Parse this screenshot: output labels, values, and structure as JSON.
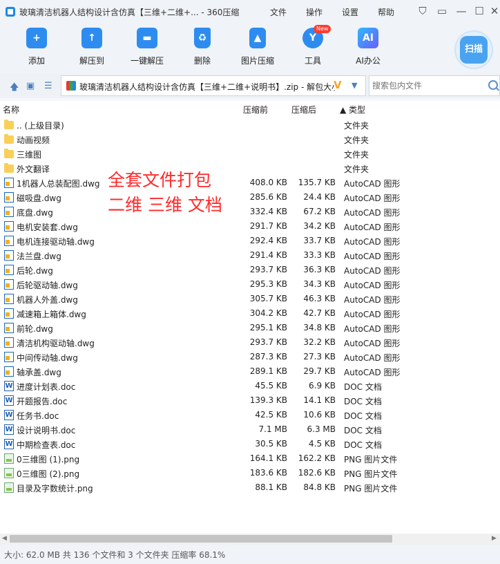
{
  "window": {
    "title": "玻璃清洁机器人结构设计含仿真【三维+二维+... - 360压缩",
    "menu": [
      "文件",
      "操作",
      "设置",
      "帮助"
    ]
  },
  "toolbar": {
    "tools": [
      {
        "label": "添加",
        "icon": "add-icon",
        "color": "#2d8cf0"
      },
      {
        "label": "解压到",
        "icon": "extract-icon",
        "color": "#2d8cf0"
      },
      {
        "label": "一键解压",
        "icon": "one-click-extract-icon",
        "color": "#2d8cf0"
      },
      {
        "label": "删除",
        "icon": "delete-icon",
        "color": "#2d8cf0"
      },
      {
        "label": "图片压缩",
        "icon": "image-compress-icon",
        "color": "#2d8cf0"
      },
      {
        "label": "工具",
        "icon": "tools-icon",
        "color": "#2d8cf0"
      },
      {
        "label": "AI办公",
        "icon": "ai-office-icon",
        "color": "#2d8cf0"
      }
    ],
    "new_badge": "New",
    "ai_glyph": "AI",
    "scan_label": "扫描"
  },
  "address": {
    "path": "玻璃清洁机器人结构设计含仿真【三维+二维+说明书】.zip - 解包大小",
    "search_placeholder": "搜索包内文件"
  },
  "columns": {
    "name": "名称",
    "before": "压缩前",
    "after": "压缩后",
    "type": "▲ 类型"
  },
  "files": [
    {
      "name": ".. (上级目录)",
      "before": "",
      "after": "",
      "type": "文件夹",
      "kind": "folder"
    },
    {
      "name": "动画视频",
      "before": "",
      "after": "",
      "type": "文件夹",
      "kind": "folder"
    },
    {
      "name": "三维图",
      "before": "",
      "after": "",
      "type": "文件夹",
      "kind": "folder"
    },
    {
      "name": "外文翻译",
      "before": "",
      "after": "",
      "type": "文件夹",
      "kind": "folder"
    },
    {
      "name": "1机器人总装配图.dwg",
      "before": "408.0 KB",
      "after": "135.7 KB",
      "type": "AutoCAD 图形",
      "kind": "dwg"
    },
    {
      "name": "磁吸盘.dwg",
      "before": "285.6 KB",
      "after": "24.4 KB",
      "type": "AutoCAD 图形",
      "kind": "dwg"
    },
    {
      "name": "底盘.dwg",
      "before": "332.4 KB",
      "after": "67.2 KB",
      "type": "AutoCAD 图形",
      "kind": "dwg"
    },
    {
      "name": "电机安装套.dwg",
      "before": "291.7 KB",
      "after": "34.2 KB",
      "type": "AutoCAD 图形",
      "kind": "dwg"
    },
    {
      "name": "电机连接驱动轴.dwg",
      "before": "292.4 KB",
      "after": "33.7 KB",
      "type": "AutoCAD 图形",
      "kind": "dwg"
    },
    {
      "name": "法兰盘.dwg",
      "before": "291.4 KB",
      "after": "33.3 KB",
      "type": "AutoCAD 图形",
      "kind": "dwg"
    },
    {
      "name": "后轮.dwg",
      "before": "293.7 KB",
      "after": "36.3 KB",
      "type": "AutoCAD 图形",
      "kind": "dwg"
    },
    {
      "name": "后轮驱动轴.dwg",
      "before": "295.3 KB",
      "after": "34.3 KB",
      "type": "AutoCAD 图形",
      "kind": "dwg"
    },
    {
      "name": "机器人外盖.dwg",
      "before": "305.7 KB",
      "after": "46.3 KB",
      "type": "AutoCAD 图形",
      "kind": "dwg"
    },
    {
      "name": "减速箱上箱体.dwg",
      "before": "304.2 KB",
      "after": "42.7 KB",
      "type": "AutoCAD 图形",
      "kind": "dwg"
    },
    {
      "name": "前轮.dwg",
      "before": "295.1 KB",
      "after": "34.8 KB",
      "type": "AutoCAD 图形",
      "kind": "dwg"
    },
    {
      "name": "清洁机构驱动轴.dwg",
      "before": "293.7 KB",
      "after": "32.2 KB",
      "type": "AutoCAD 图形",
      "kind": "dwg"
    },
    {
      "name": "中间传动轴.dwg",
      "before": "287.3 KB",
      "after": "27.3 KB",
      "type": "AutoCAD 图形",
      "kind": "dwg"
    },
    {
      "name": "轴承盖.dwg",
      "before": "289.1 KB",
      "after": "29.7 KB",
      "type": "AutoCAD 图形",
      "kind": "dwg"
    },
    {
      "name": "进度计划表.doc",
      "before": "45.5 KB",
      "after": "6.9 KB",
      "type": "DOC 文档",
      "kind": "doc"
    },
    {
      "name": "开题报告.doc",
      "before": "139.3 KB",
      "after": "14.1 KB",
      "type": "DOC 文档",
      "kind": "doc"
    },
    {
      "name": "任务书.doc",
      "before": "42.5 KB",
      "after": "10.6 KB",
      "type": "DOC 文档",
      "kind": "doc"
    },
    {
      "name": "设计说明书.doc",
      "before": "7.1 MB",
      "after": "6.3 MB",
      "type": "DOC 文档",
      "kind": "doc"
    },
    {
      "name": "中期检查表.doc",
      "before": "30.5 KB",
      "after": "4.5 KB",
      "type": "DOC 文档",
      "kind": "doc"
    },
    {
      "name": "0三维图 (1).png",
      "before": "164.1 KB",
      "after": "162.2 KB",
      "type": "PNG 图片文件",
      "kind": "png"
    },
    {
      "name": "0三维图 (2).png",
      "before": "183.6 KB",
      "after": "182.6 KB",
      "type": "PNG 图片文件",
      "kind": "png"
    },
    {
      "name": "目录及字数统计.png",
      "before": "88.1 KB",
      "after": "84.8 KB",
      "type": "PNG 图片文件",
      "kind": "png"
    }
  ],
  "overlay": {
    "line1": "全套文件打包",
    "line2": "二维 三维 文档"
  },
  "status": "大小: 62.0 MB 共 136 个文件和 3 个文件夹 压缩率 68.1%"
}
